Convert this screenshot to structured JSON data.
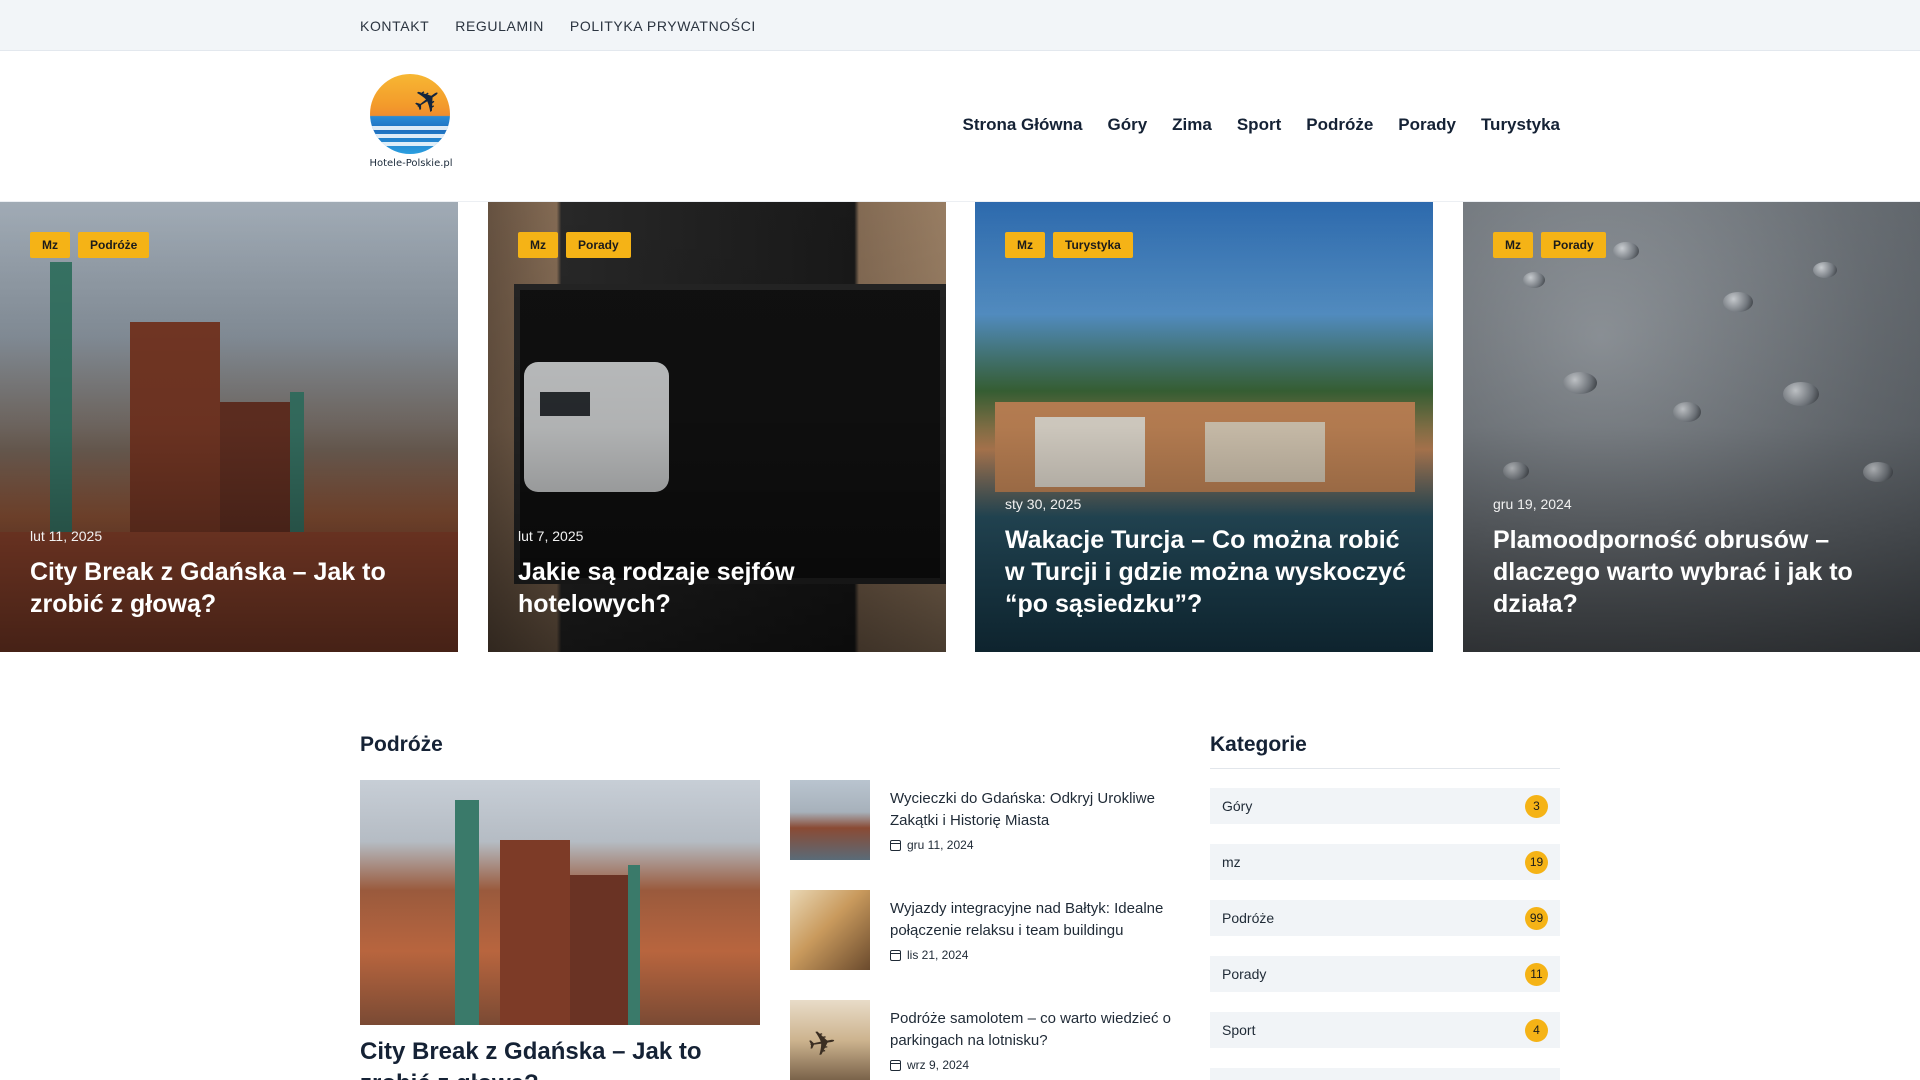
{
  "topbar": {
    "links": [
      "KONTAKT",
      "REGULAMIN",
      "POLITYKA PRYWATNOŚCI"
    ]
  },
  "header": {
    "logo_text": "Hotele-Polskie.pl",
    "nav": [
      "Strona Główna",
      "Góry",
      "Zima",
      "Sport",
      "Podróże",
      "Porady",
      "Turystyka"
    ]
  },
  "slider": [
    {
      "tags": [
        "Mz",
        "Podróże"
      ],
      "date": "lut 11, 2025",
      "title": "City Break z Gdańska – Jak to zrobić z głową?"
    },
    {
      "tags": [
        "Mz",
        "Porady"
      ],
      "date": "lut 7, 2025",
      "title": "Jakie są rodzaje sejfów hotelowych?"
    },
    {
      "tags": [
        "Mz",
        "Turystyka"
      ],
      "date": "sty 30, 2025",
      "title": "Wakacje Turcja – Co można robić w Turcji i gdzie można wyskoczyć “po sąsiedzku”?"
    },
    {
      "tags": [
        "Mz",
        "Porady"
      ],
      "date": "gru 19, 2024",
      "title": "Plamoodporność obrusów – dlaczego warto wybrać i jak to działa?"
    }
  ],
  "section": {
    "title": "Podróże",
    "featured_title": "City Break z Gdańska – Jak to zrobić z głową?",
    "items": [
      {
        "title": "Wycieczki do Gdańska: Odkryj Urokliwe Zakątki i Historię Miasta",
        "date": "gru 11, 2024"
      },
      {
        "title": "Wyjazdy integracyjne nad Bałtyk: Idealne połączenie relaksu i team buildingu",
        "date": "lis 21, 2024"
      },
      {
        "title": "Podróże samolotem – co warto wiedzieć o parkingach na lotnisku?",
        "date": "wrz 9, 2024"
      }
    ]
  },
  "categories": {
    "title": "Kategorie",
    "items": [
      {
        "label": "Góry",
        "count": "3"
      },
      {
        "label": "mz",
        "count": "19"
      },
      {
        "label": "Podróże",
        "count": "99"
      },
      {
        "label": "Porady",
        "count": "11"
      },
      {
        "label": "Sport",
        "count": "4"
      }
    ]
  },
  "colors": {
    "accent": "#f5b316",
    "text": "#152235",
    "topbar_bg": "#f2f5f8"
  }
}
